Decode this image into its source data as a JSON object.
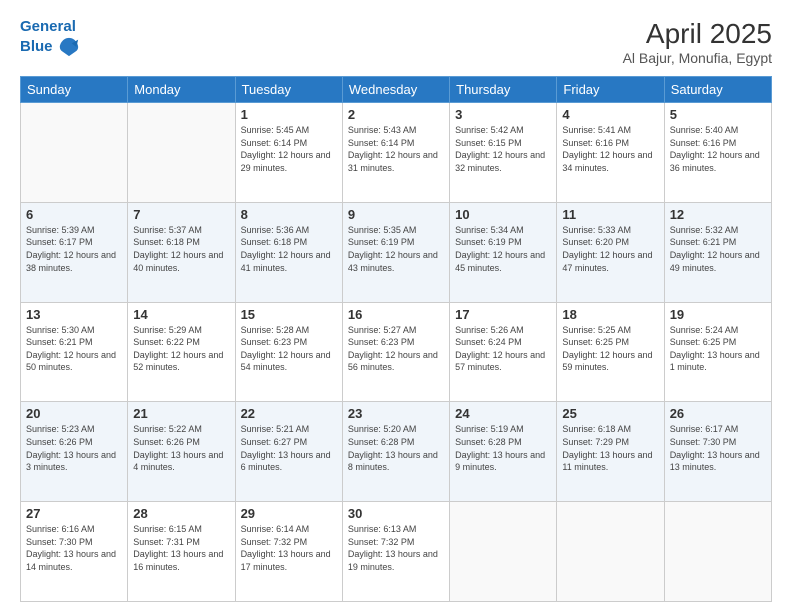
{
  "logo": {
    "line1": "General",
    "line2": "Blue"
  },
  "header": {
    "title": "April 2025",
    "subtitle": "Al Bajur, Monufia, Egypt"
  },
  "weekdays": [
    "Sunday",
    "Monday",
    "Tuesday",
    "Wednesday",
    "Thursday",
    "Friday",
    "Saturday"
  ],
  "rows": [
    [
      {
        "day": "",
        "sunrise": "",
        "sunset": "",
        "daylight": ""
      },
      {
        "day": "",
        "sunrise": "",
        "sunset": "",
        "daylight": ""
      },
      {
        "day": "1",
        "sunrise": "Sunrise: 5:45 AM",
        "sunset": "Sunset: 6:14 PM",
        "daylight": "Daylight: 12 hours and 29 minutes."
      },
      {
        "day": "2",
        "sunrise": "Sunrise: 5:43 AM",
        "sunset": "Sunset: 6:14 PM",
        "daylight": "Daylight: 12 hours and 31 minutes."
      },
      {
        "day": "3",
        "sunrise": "Sunrise: 5:42 AM",
        "sunset": "Sunset: 6:15 PM",
        "daylight": "Daylight: 12 hours and 32 minutes."
      },
      {
        "day": "4",
        "sunrise": "Sunrise: 5:41 AM",
        "sunset": "Sunset: 6:16 PM",
        "daylight": "Daylight: 12 hours and 34 minutes."
      },
      {
        "day": "5",
        "sunrise": "Sunrise: 5:40 AM",
        "sunset": "Sunset: 6:16 PM",
        "daylight": "Daylight: 12 hours and 36 minutes."
      }
    ],
    [
      {
        "day": "6",
        "sunrise": "Sunrise: 5:39 AM",
        "sunset": "Sunset: 6:17 PM",
        "daylight": "Daylight: 12 hours and 38 minutes."
      },
      {
        "day": "7",
        "sunrise": "Sunrise: 5:37 AM",
        "sunset": "Sunset: 6:18 PM",
        "daylight": "Daylight: 12 hours and 40 minutes."
      },
      {
        "day": "8",
        "sunrise": "Sunrise: 5:36 AM",
        "sunset": "Sunset: 6:18 PM",
        "daylight": "Daylight: 12 hours and 41 minutes."
      },
      {
        "day": "9",
        "sunrise": "Sunrise: 5:35 AM",
        "sunset": "Sunset: 6:19 PM",
        "daylight": "Daylight: 12 hours and 43 minutes."
      },
      {
        "day": "10",
        "sunrise": "Sunrise: 5:34 AM",
        "sunset": "Sunset: 6:19 PM",
        "daylight": "Daylight: 12 hours and 45 minutes."
      },
      {
        "day": "11",
        "sunrise": "Sunrise: 5:33 AM",
        "sunset": "Sunset: 6:20 PM",
        "daylight": "Daylight: 12 hours and 47 minutes."
      },
      {
        "day": "12",
        "sunrise": "Sunrise: 5:32 AM",
        "sunset": "Sunset: 6:21 PM",
        "daylight": "Daylight: 12 hours and 49 minutes."
      }
    ],
    [
      {
        "day": "13",
        "sunrise": "Sunrise: 5:30 AM",
        "sunset": "Sunset: 6:21 PM",
        "daylight": "Daylight: 12 hours and 50 minutes."
      },
      {
        "day": "14",
        "sunrise": "Sunrise: 5:29 AM",
        "sunset": "Sunset: 6:22 PM",
        "daylight": "Daylight: 12 hours and 52 minutes."
      },
      {
        "day": "15",
        "sunrise": "Sunrise: 5:28 AM",
        "sunset": "Sunset: 6:23 PM",
        "daylight": "Daylight: 12 hours and 54 minutes."
      },
      {
        "day": "16",
        "sunrise": "Sunrise: 5:27 AM",
        "sunset": "Sunset: 6:23 PM",
        "daylight": "Daylight: 12 hours and 56 minutes."
      },
      {
        "day": "17",
        "sunrise": "Sunrise: 5:26 AM",
        "sunset": "Sunset: 6:24 PM",
        "daylight": "Daylight: 12 hours and 57 minutes."
      },
      {
        "day": "18",
        "sunrise": "Sunrise: 5:25 AM",
        "sunset": "Sunset: 6:25 PM",
        "daylight": "Daylight: 12 hours and 59 minutes."
      },
      {
        "day": "19",
        "sunrise": "Sunrise: 5:24 AM",
        "sunset": "Sunset: 6:25 PM",
        "daylight": "Daylight: 13 hours and 1 minute."
      }
    ],
    [
      {
        "day": "20",
        "sunrise": "Sunrise: 5:23 AM",
        "sunset": "Sunset: 6:26 PM",
        "daylight": "Daylight: 13 hours and 3 minutes."
      },
      {
        "day": "21",
        "sunrise": "Sunrise: 5:22 AM",
        "sunset": "Sunset: 6:26 PM",
        "daylight": "Daylight: 13 hours and 4 minutes."
      },
      {
        "day": "22",
        "sunrise": "Sunrise: 5:21 AM",
        "sunset": "Sunset: 6:27 PM",
        "daylight": "Daylight: 13 hours and 6 minutes."
      },
      {
        "day": "23",
        "sunrise": "Sunrise: 5:20 AM",
        "sunset": "Sunset: 6:28 PM",
        "daylight": "Daylight: 13 hours and 8 minutes."
      },
      {
        "day": "24",
        "sunrise": "Sunrise: 5:19 AM",
        "sunset": "Sunset: 6:28 PM",
        "daylight": "Daylight: 13 hours and 9 minutes."
      },
      {
        "day": "25",
        "sunrise": "Sunrise: 6:18 AM",
        "sunset": "Sunset: 7:29 PM",
        "daylight": "Daylight: 13 hours and 11 minutes."
      },
      {
        "day": "26",
        "sunrise": "Sunrise: 6:17 AM",
        "sunset": "Sunset: 7:30 PM",
        "daylight": "Daylight: 13 hours and 13 minutes."
      }
    ],
    [
      {
        "day": "27",
        "sunrise": "Sunrise: 6:16 AM",
        "sunset": "Sunset: 7:30 PM",
        "daylight": "Daylight: 13 hours and 14 minutes."
      },
      {
        "day": "28",
        "sunrise": "Sunrise: 6:15 AM",
        "sunset": "Sunset: 7:31 PM",
        "daylight": "Daylight: 13 hours and 16 minutes."
      },
      {
        "day": "29",
        "sunrise": "Sunrise: 6:14 AM",
        "sunset": "Sunset: 7:32 PM",
        "daylight": "Daylight: 13 hours and 17 minutes."
      },
      {
        "day": "30",
        "sunrise": "Sunrise: 6:13 AM",
        "sunset": "Sunset: 7:32 PM",
        "daylight": "Daylight: 13 hours and 19 minutes."
      },
      {
        "day": "",
        "sunrise": "",
        "sunset": "",
        "daylight": ""
      },
      {
        "day": "",
        "sunrise": "",
        "sunset": "",
        "daylight": ""
      },
      {
        "day": "",
        "sunrise": "",
        "sunset": "",
        "daylight": ""
      }
    ]
  ]
}
